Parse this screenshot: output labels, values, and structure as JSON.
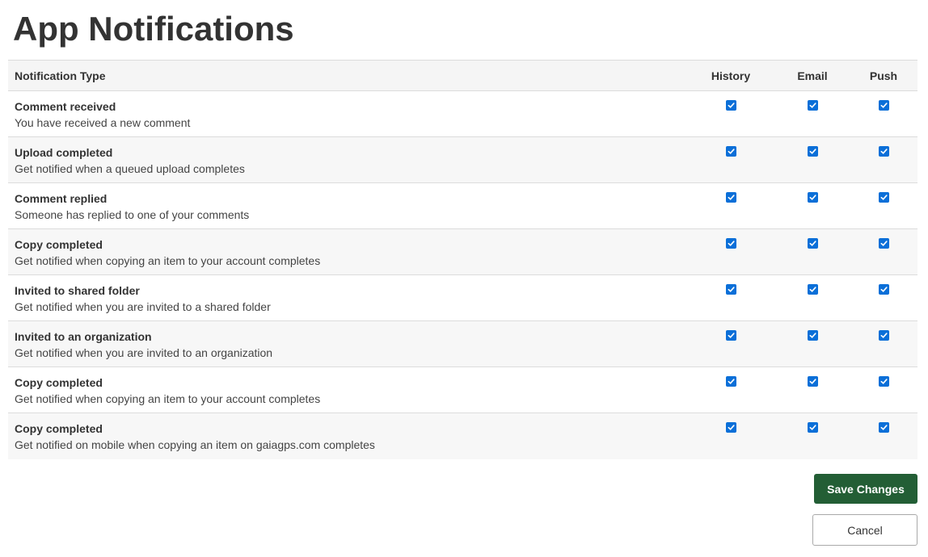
{
  "page": {
    "title": "App Notifications"
  },
  "table": {
    "headers": {
      "type": "Notification Type",
      "history": "History",
      "email": "Email",
      "push": "Push"
    },
    "rows": [
      {
        "title": "Comment received",
        "description": "You have received a new comment",
        "history": true,
        "email": true,
        "push": true
      },
      {
        "title": "Upload completed",
        "description": "Get notified when a queued upload completes",
        "history": true,
        "email": true,
        "push": true
      },
      {
        "title": "Comment replied",
        "description": "Someone has replied to one of your comments",
        "history": true,
        "email": true,
        "push": true
      },
      {
        "title": "Copy completed",
        "description": "Get notified when copying an item to your account completes",
        "history": true,
        "email": true,
        "push": true
      },
      {
        "title": "Invited to shared folder",
        "description": "Get notified when you are invited to a shared folder",
        "history": true,
        "email": true,
        "push": true
      },
      {
        "title": "Invited to an organization",
        "description": "Get notified when you are invited to an organization",
        "history": true,
        "email": true,
        "push": true
      },
      {
        "title": "Copy completed",
        "description": "Get notified when copying an item to your account completes",
        "history": true,
        "email": true,
        "push": true
      },
      {
        "title": "Copy completed",
        "description": "Get notified on mobile when copying an item on gaiagps.com completes",
        "history": true,
        "email": true,
        "push": true
      }
    ]
  },
  "actions": {
    "save_label": "Save Changes",
    "cancel_label": "Cancel"
  },
  "colors": {
    "checkbox": "#0b6fd8",
    "save_button": "#235e35",
    "row_alt": "#f7f7f7",
    "header_bg": "#f5f5f5"
  }
}
